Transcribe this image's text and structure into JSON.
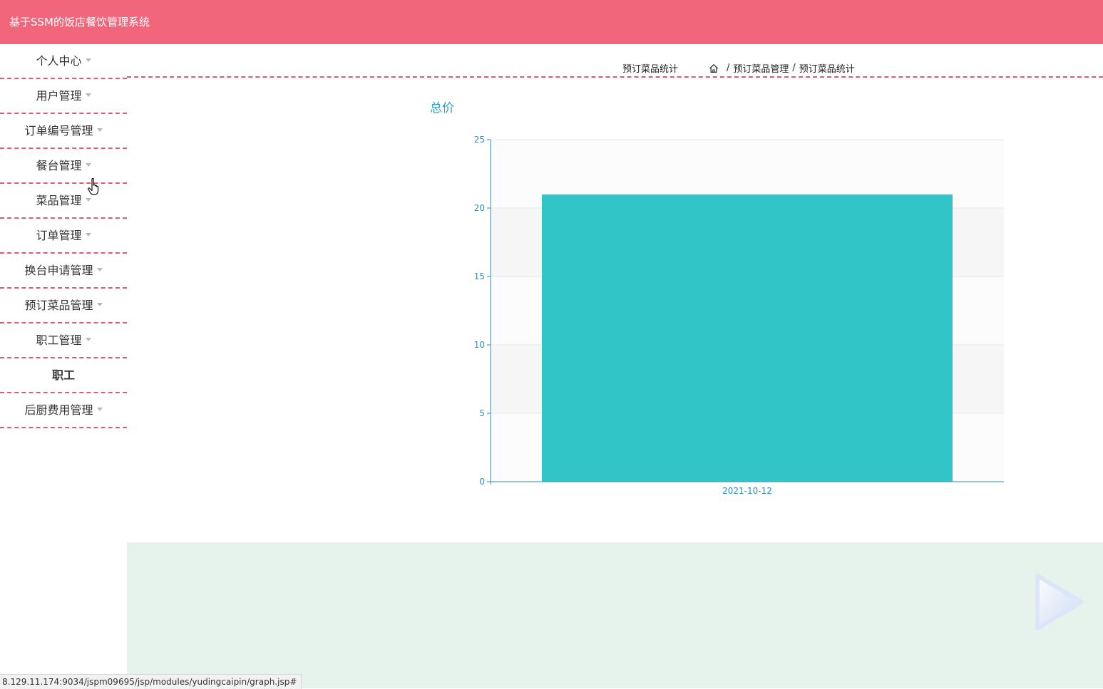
{
  "app": {
    "title": "基于SSM的饭店餐饮管理系统"
  },
  "sidebar": {
    "items": [
      {
        "label": "个人中心",
        "has_caret": true
      },
      {
        "label": "用户管理",
        "has_caret": true
      },
      {
        "label": "订单编号管理",
        "has_caret": true
      },
      {
        "label": "餐台管理",
        "has_caret": true
      },
      {
        "label": "菜品管理",
        "has_caret": true
      },
      {
        "label": "订单管理",
        "has_caret": true
      },
      {
        "label": "换台申请管理",
        "has_caret": true
      },
      {
        "label": "预订菜品管理",
        "has_caret": true
      },
      {
        "label": "职工管理",
        "has_caret": true
      },
      {
        "label": "职工",
        "has_caret": false
      },
      {
        "label": "后厨费用管理",
        "has_caret": true
      }
    ]
  },
  "header": {
    "page_title": "预订菜品统计",
    "breadcrumb": [
      "预订菜品管理",
      "预订菜品统计"
    ],
    "breadcrumb_separator": "/"
  },
  "chart_data": {
    "type": "bar",
    "title": "总价",
    "categories": [
      "2021-10-12"
    ],
    "values": [
      21
    ],
    "ylim": [
      0,
      25
    ],
    "yticks": [
      0,
      5,
      10,
      15,
      20,
      25
    ],
    "grid": true,
    "bar_color": "#31c5c7",
    "axis_color": "#2a8fbd"
  },
  "status_bar": {
    "url": "8.129.11.174:9034/jspm09695/jsp/modules/yudingcaipin/graph.jsp#"
  },
  "colors": {
    "topbar": "#f2667b",
    "divider": "#e05a70",
    "footer": "#e6f2ec"
  }
}
